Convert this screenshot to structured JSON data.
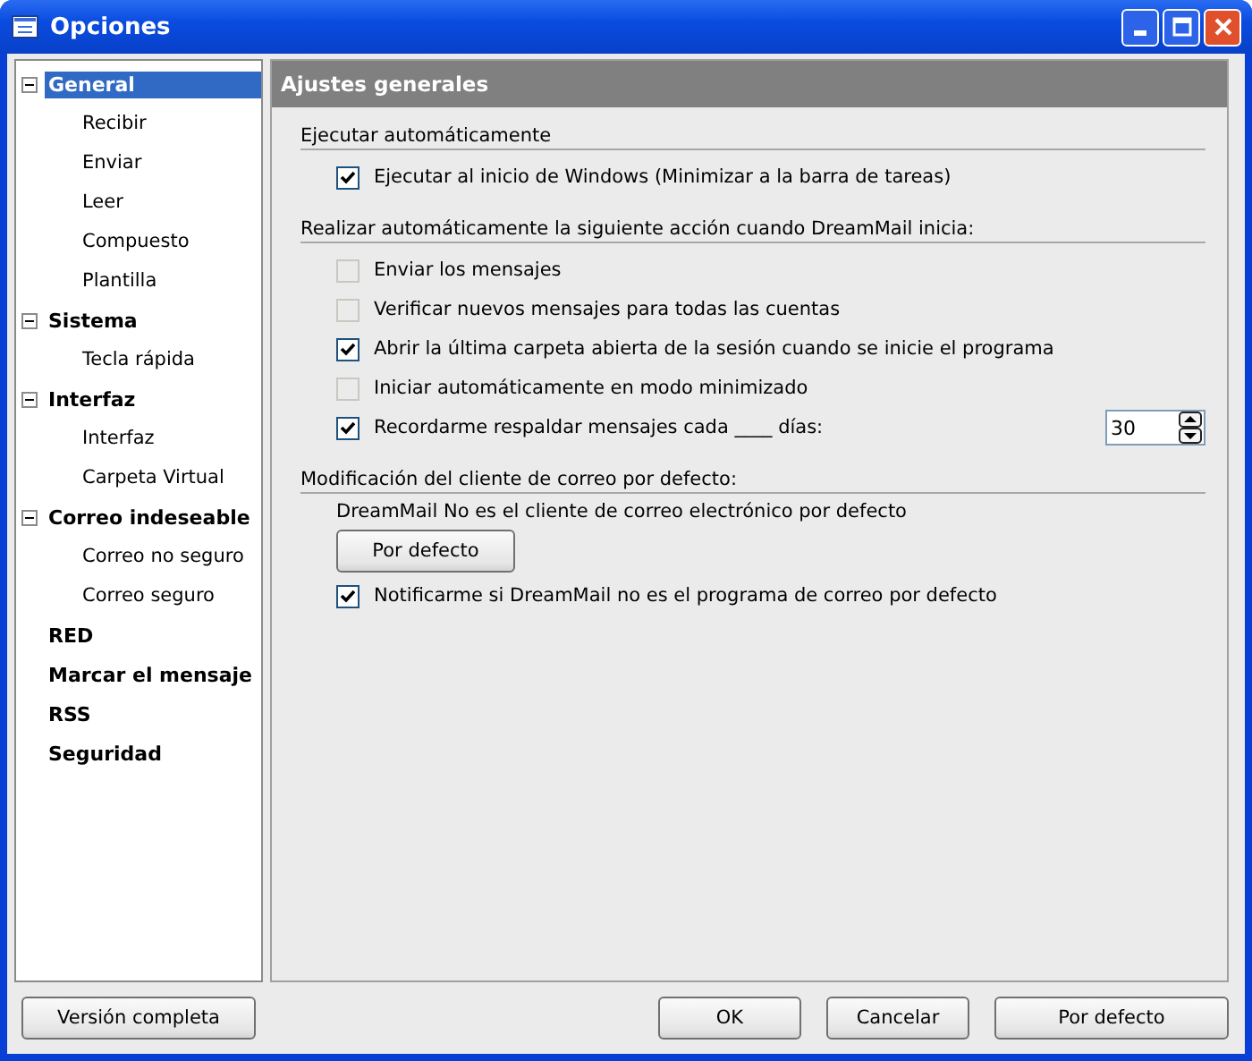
{
  "window": {
    "title": "Opciones"
  },
  "tree": [
    {
      "label": "General",
      "selected": true,
      "expanded": true,
      "children": [
        {
          "label": "Recibir",
          "selected": false
        },
        {
          "label": "Enviar",
          "selected": false
        },
        {
          "label": "Leer",
          "selected": false
        },
        {
          "label": "Compuesto",
          "selected": false
        },
        {
          "label": "Plantilla",
          "selected": false
        }
      ]
    },
    {
      "label": "Sistema",
      "selected": false,
      "expanded": true,
      "children": [
        {
          "label": "Tecla rápida",
          "selected": false
        }
      ]
    },
    {
      "label": "Interfaz",
      "selected": false,
      "expanded": true,
      "children": [
        {
          "label": "Interfaz",
          "selected": false
        },
        {
          "label": "Carpeta Virtual",
          "selected": false
        }
      ]
    },
    {
      "label": "Correo indeseable",
      "selected": false,
      "expanded": true,
      "children": [
        {
          "label": "Correo no seguro",
          "selected": false
        },
        {
          "label": "Correo seguro",
          "selected": false
        }
      ]
    },
    {
      "label": "RED",
      "selected": false
    },
    {
      "label": "Marcar el mensaje",
      "selected": false
    },
    {
      "label": "RSS",
      "selected": false
    },
    {
      "label": "Seguridad",
      "selected": false
    }
  ],
  "panel": {
    "title": "Ajustes generales",
    "sections": [
      {
        "heading": "Ejecutar automáticamente",
        "items": [
          {
            "kind": "checkbox",
            "label": "Ejecutar al inicio de Windows (Minimizar a la barra de tareas)",
            "checked": true,
            "disabled": false
          }
        ]
      },
      {
        "heading": "Realizar automáticamente la siguiente acción cuando DreamMail inicia:",
        "items": [
          {
            "kind": "checkbox",
            "label": "Enviar los mensajes",
            "checked": false,
            "disabled": true
          },
          {
            "kind": "checkbox",
            "label": "Verificar nuevos mensajes para todas las cuentas",
            "checked": false,
            "disabled": true
          },
          {
            "kind": "checkbox",
            "label": "Abrir la última carpeta abierta de la sesión cuando se inicie el programa",
            "checked": true,
            "disabled": false
          },
          {
            "kind": "checkbox",
            "label": "Iniciar automáticamente en modo minimizado",
            "checked": false,
            "disabled": true
          },
          {
            "kind": "spin",
            "label": "Recordarme respaldar mensajes cada ____ días:",
            "checked": true,
            "disabled": false,
            "value": "30"
          }
        ]
      },
      {
        "heading": "Modificación del cliente de correo por defecto:",
        "items": [
          {
            "kind": "note",
            "label": "DreamMail No es el cliente de correo electrónico por defecto"
          },
          {
            "kind": "button",
            "label": "Por defecto"
          },
          {
            "kind": "checkbox",
            "label": "Notificarme si DreamMail no es el programa de correo por defecto",
            "checked": true,
            "disabled": false
          }
        ]
      }
    ]
  },
  "footer": {
    "left_button": "Versión completa",
    "buttons": [
      "OK",
      "Cancelar",
      "Por defecto"
    ]
  }
}
